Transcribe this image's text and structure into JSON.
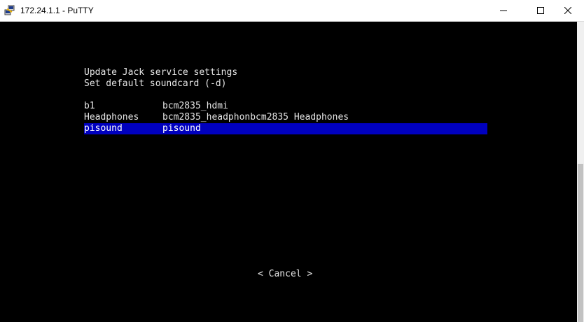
{
  "window": {
    "title": "172.24.1.1 - PuTTY",
    "icons": {
      "app": "putty-icon",
      "minimize": "minimize-icon",
      "maximize": "maximize-icon",
      "close": "close-icon"
    }
  },
  "dialog": {
    "title": "Update Jack service settings",
    "subtitle": "Set default soundcard (-d)",
    "options": [
      {
        "name": "b1",
        "description": "bcm2835_hdmi",
        "selected": false
      },
      {
        "name": "Headphones",
        "description": "bcm2835_headphonbcm2835 Headphones",
        "selected": false
      },
      {
        "name": "pisound",
        "description": "pisound",
        "selected": true
      }
    ],
    "cancel_label": "< Cancel >"
  },
  "colors": {
    "terminal_bg": "#000000",
    "text": "#e6e6e6",
    "selection": "#0000bf",
    "titlebar": "#ffffff"
  }
}
